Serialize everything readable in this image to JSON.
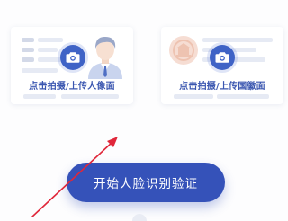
{
  "cards": {
    "portrait": {
      "caption": "点击拍摄/上传人像面",
      "illustration_icon": "person-avatar-icon",
      "action_icon": "camera-icon"
    },
    "emblem": {
      "caption": "点击拍摄/上传国徽面",
      "illustration_icon": "national-emblem-icon",
      "action_icon": "camera-icon"
    }
  },
  "actions": {
    "start_label": "开始人脸识别验证"
  },
  "colors": {
    "accent": "#3552b9",
    "caption": "#3a56b0",
    "arrow": "#e0273a",
    "background": "#fdfdfe"
  }
}
